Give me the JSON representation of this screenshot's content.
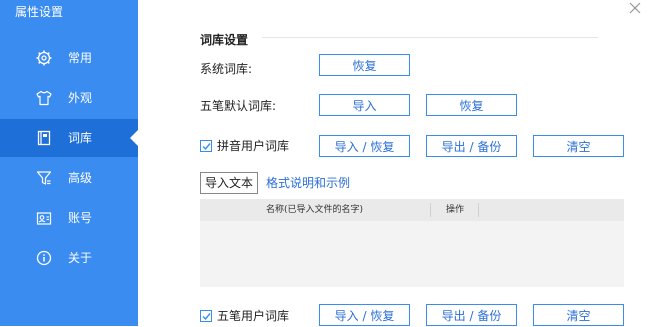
{
  "window": {
    "title": "属性设置"
  },
  "sidebar": {
    "items": [
      {
        "label": "常用",
        "icon": "gear-icon"
      },
      {
        "label": "外观",
        "icon": "shirt-icon"
      },
      {
        "label": "词库",
        "icon": "book-icon",
        "active": true
      },
      {
        "label": "高级",
        "icon": "filter-icon"
      },
      {
        "label": "账号",
        "icon": "account-icon"
      },
      {
        "label": "关于",
        "icon": "info-icon"
      }
    ]
  },
  "main": {
    "section_title": "词库设置",
    "system_dict": {
      "label": "系统词库:",
      "restore": "恢复"
    },
    "wubi_default": {
      "label": "五笔默认词库:",
      "import": "导入",
      "restore": "恢复"
    },
    "pinyin_user": {
      "label": "拼音用户词库",
      "checked": true,
      "import_restore": "导入 / 恢复",
      "export_backup": "导出 / 备份",
      "clear": "清空"
    },
    "import_text": "导入文本",
    "format_link": "格式说明和示例",
    "table": {
      "col_name": "名称(已导入文件的名字)",
      "col_action": "操作"
    },
    "wubi_user": {
      "label": "五笔用户词库",
      "checked": true,
      "import_restore": "导入 / 恢复",
      "export_backup": "导出 / 备份",
      "clear": "清空"
    }
  },
  "colors": {
    "accent": "#3b8cf0",
    "sidebar_active": "#1f6fd9"
  }
}
